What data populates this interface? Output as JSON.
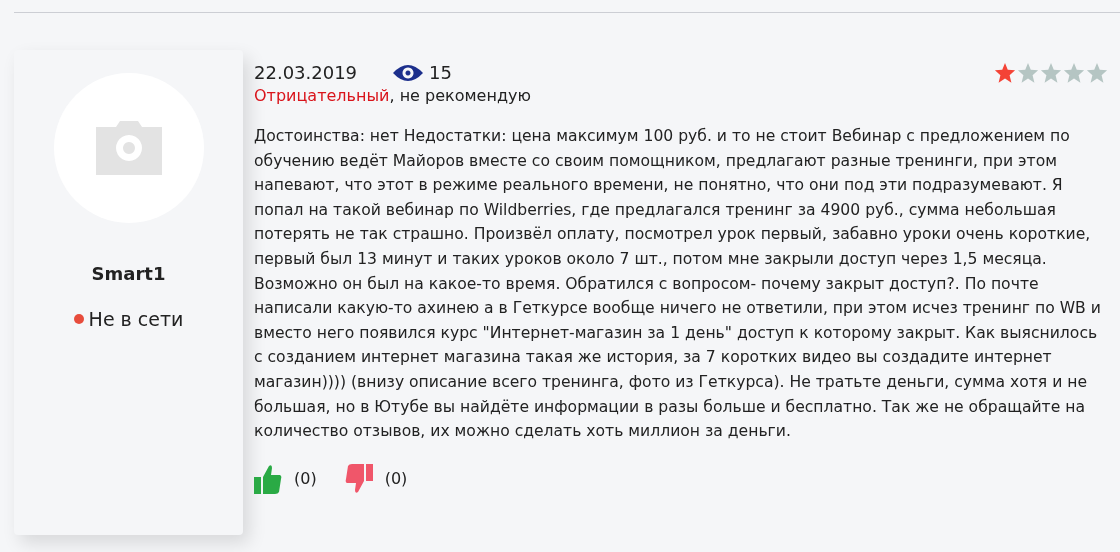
{
  "author": {
    "name": "Smart1",
    "status": {
      "label": "Не в сети",
      "color": "#e74c3c"
    }
  },
  "review": {
    "date": "22.03.2019",
    "views": "15",
    "stars": 1,
    "verdict": "Отрицательный",
    "verdict_rest": ", не рекомендую",
    "text": "Достоинства: нет Недостатки: цена максимум 100 руб. и то не стоит Вебинар с предложением по обучению ведёт Майоров вместе со своим помощником, предлагают разные тренинги, при этом напевают, что этот в режиме реального времени, не понятно, что они под эти подразумевают. Я попал на такой вебинар по Wildberries, где предлагался тренинг за 4900 руб., сумма небольшая потерять не так страшно. Произвёл оплату, посмотрел урок первый, забавно уроки очень короткие, первый был 13 минут и таких уроков около 7 шт., потом мне закрыли доступ через 1,5 месяца. Возможно он был на какое-то время. Обратился с вопросом- почему закрыт доступ?. По почте написали какую-то ахинею а в Геткурсе вообще ничего не ответили, при этом исчез тренинг по WB и вместо него появился курс \"Интернет-магазин за 1 день\" доступ к которому закрыт. Как выяснилось с созданием интернет магазина такая же история, за 7 коротких видео вы создадите интернет магазин)))) (внизу описание всего тренинга, фото из Геткурса). Не тратьте деньги, сумма хотя и не большая, но в Ютубе вы найдёте информации в разы больше и бесплатно. Так же не обращайте на количество отзывов, их можно сделать хоть миллион за деньги.",
    "likes": "(0)",
    "dislikes": "(0)"
  }
}
